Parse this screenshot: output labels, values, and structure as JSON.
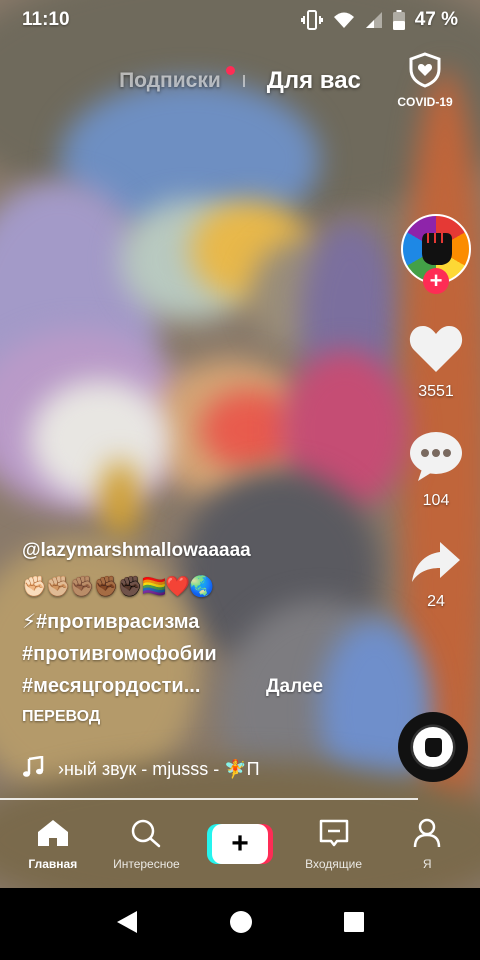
{
  "status": {
    "time": "11:10",
    "battery": "47 %"
  },
  "tabs": {
    "following": "Подписки",
    "for_you": "Для вас"
  },
  "covid": {
    "label": "COVID-19"
  },
  "rail": {
    "likes": "3551",
    "comments": "104",
    "shares": "24"
  },
  "caption": {
    "username": "@lazymarshmallowaaaaa",
    "emojis": "✊🏻✊🏼✊🏽✊🏾✊🏿🏳️‍🌈❤️🌏",
    "tag1": "⚡#противрасизма",
    "tag2": "#противгомофобии",
    "tag3": "#месяцгордости...",
    "more": "Далее",
    "translate": "ПЕРЕВОД"
  },
  "music": {
    "text": "›ный звук - mjusss - 🧚П"
  },
  "nav": {
    "home": "Главная",
    "discover": "Интересное",
    "inbox": "Входящие",
    "me": "Я"
  },
  "colors": {
    "accent": "#fe2c55",
    "cyan": "#25f4ee"
  },
  "icons": [
    "vibrate-icon",
    "wifi-icon",
    "signal-icon",
    "battery-icon",
    "shield-heart-icon",
    "fist-icon",
    "heart-icon",
    "comment-icon",
    "share-icon",
    "music-note-icon",
    "home-icon",
    "search-icon",
    "plus-icon",
    "inbox-icon",
    "profile-icon",
    "back-icon",
    "home-circle-icon",
    "recents-icon"
  ]
}
